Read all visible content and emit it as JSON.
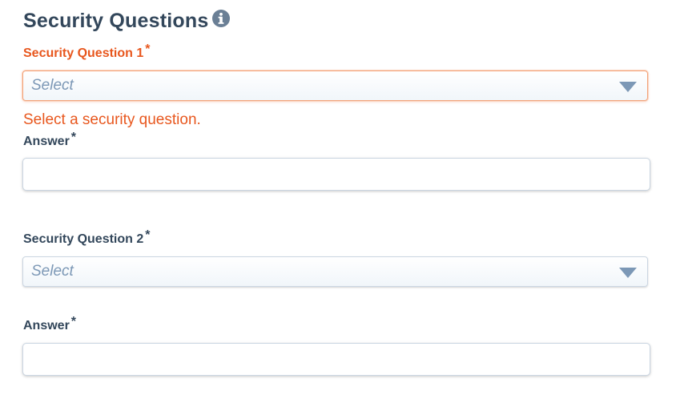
{
  "section": {
    "title": "Security Questions",
    "info_icon": "info-circle-icon"
  },
  "question1": {
    "label": "Security Question 1",
    "required_marker": "*",
    "select_placeholder": "Select",
    "error_message": "Select a security question.",
    "answer_label": "Answer",
    "answer_required_marker": "*",
    "answer_value": ""
  },
  "question2": {
    "label": "Security Question 2",
    "required_marker": "*",
    "select_placeholder": "Select",
    "answer_label": "Answer",
    "answer_required_marker": "*",
    "answer_value": ""
  },
  "colors": {
    "heading": "#33475b",
    "error": "#e8571e",
    "placeholder": "#7c98b6",
    "border": "#cbd6e2"
  }
}
